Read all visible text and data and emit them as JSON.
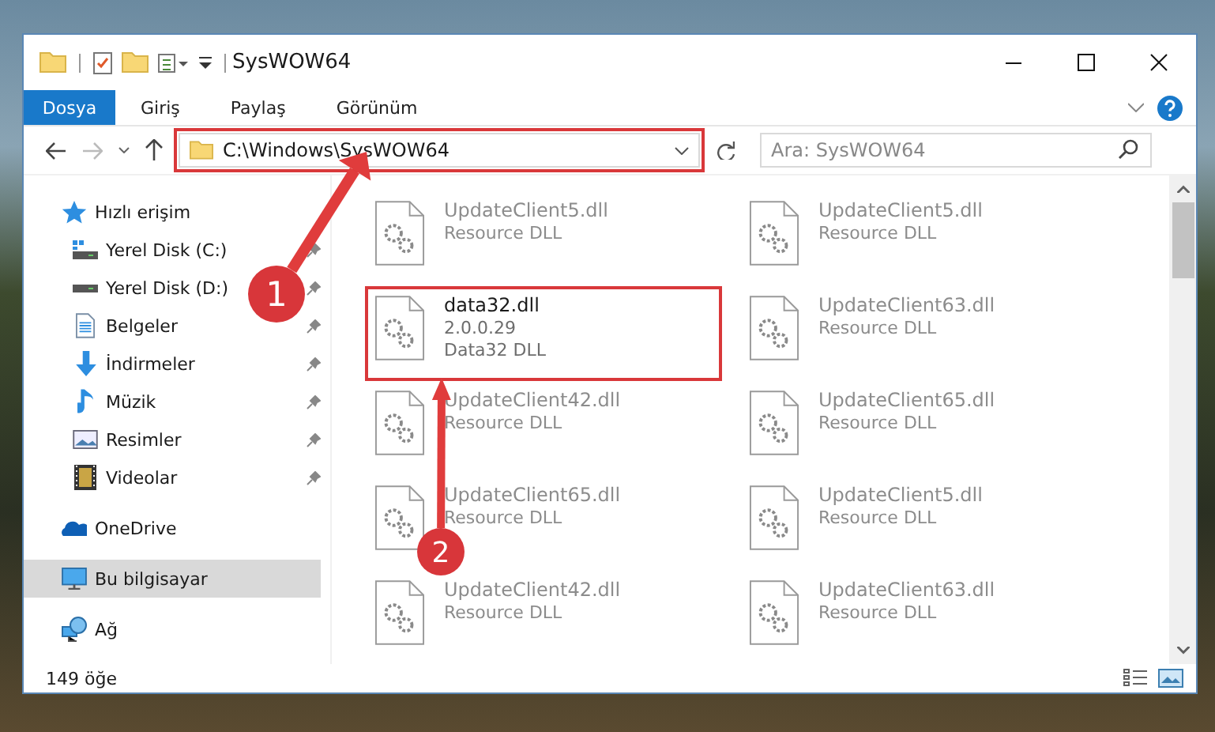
{
  "window": {
    "title": "SysWOW64"
  },
  "ribbon_tabs": [
    {
      "label": "Dosya",
      "kind": "file"
    },
    {
      "label": "Giriş",
      "kind": "tab"
    },
    {
      "label": "Paylaş",
      "kind": "tab"
    },
    {
      "label": "Görünüm",
      "kind": "tab"
    }
  ],
  "address_bar": {
    "path": "C:\\Windows\\SysWOW64",
    "highlighted": true
  },
  "search": {
    "placeholder": "Ara: SysWOW64"
  },
  "sidebar": {
    "items": [
      {
        "label": "Hızlı erişim",
        "selected": false,
        "children": [
          {
            "label": "Yerel Disk (C:)",
            "pinned": true,
            "selected": false
          },
          {
            "label": "Yerel Disk (D:)",
            "pinned": true,
            "selected": false
          },
          {
            "label": "Belgeler",
            "pinned": true,
            "selected": false
          },
          {
            "label": "İndirmeler",
            "pinned": true,
            "selected": false
          },
          {
            "label": "Müzik",
            "pinned": true,
            "selected": false
          },
          {
            "label": "Resimler",
            "pinned": true,
            "selected": false
          },
          {
            "label": "Videolar",
            "pinned": true,
            "selected": false
          }
        ]
      },
      {
        "label": "OneDrive",
        "selected": false
      },
      {
        "label": "Bu bilgisayar",
        "selected": true
      },
      {
        "label": "Ağ",
        "selected": false
      }
    ]
  },
  "files": [
    {
      "name": "UpdateClient5.dll",
      "details": [
        "Resource DLL"
      ],
      "blurred": true,
      "highlighted": false
    },
    {
      "name": "UpdateClient5.dll",
      "details": [
        "Resource DLL"
      ],
      "blurred": true,
      "highlighted": false
    },
    {
      "name": "data32.dll",
      "details": [
        "2.0.0.29",
        "Data32 DLL"
      ],
      "blurred": false,
      "highlighted": true
    },
    {
      "name": "UpdateClient63.dll",
      "details": [
        "Resource DLL"
      ],
      "blurred": true,
      "highlighted": false
    },
    {
      "name": "UpdateClient42.dll",
      "details": [
        "Resource DLL"
      ],
      "blurred": true,
      "highlighted": false
    },
    {
      "name": "UpdateClient65.dll",
      "details": [
        "Resource DLL"
      ],
      "blurred": true,
      "highlighted": false
    },
    {
      "name": "UpdateClient65.dll",
      "details": [
        "Resource DLL"
      ],
      "blurred": true,
      "highlighted": false
    },
    {
      "name": "UpdateClient5.dll",
      "details": [
        "Resource DLL"
      ],
      "blurred": true,
      "highlighted": false
    },
    {
      "name": "UpdateClient42.dll",
      "details": [
        "Resource DLL"
      ],
      "blurred": true,
      "highlighted": false
    },
    {
      "name": "UpdateClient63.dll",
      "details": [
        "Resource DLL"
      ],
      "blurred": true,
      "highlighted": false
    }
  ],
  "callouts": [
    {
      "number": "1"
    },
    {
      "number": "2"
    }
  ],
  "status_bar": {
    "count": "149 öğe"
  }
}
